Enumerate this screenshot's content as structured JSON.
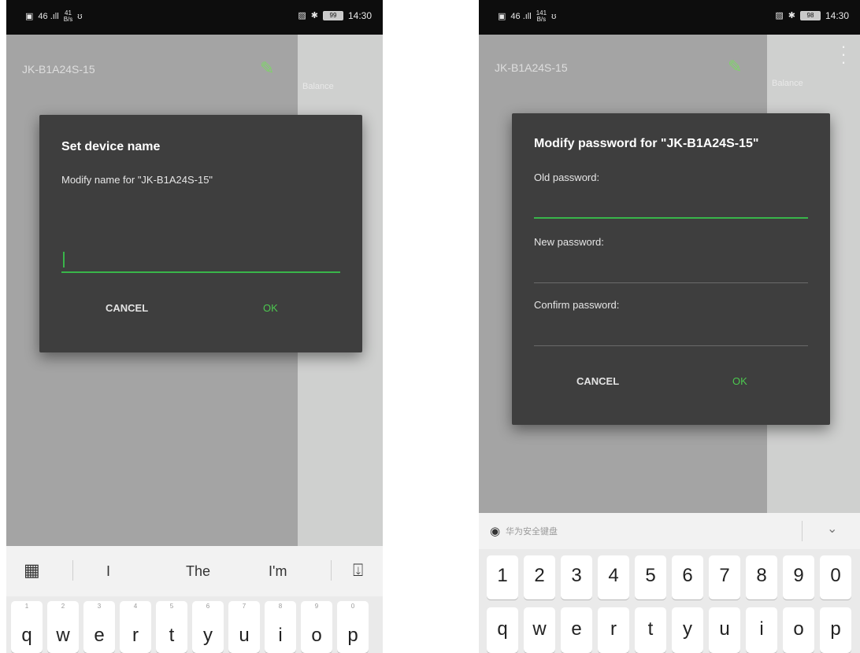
{
  "phone1": {
    "status": {
      "signal": "46 .ıll",
      "speed_top": "41",
      "speed_bottom": "B/s",
      "time": "14:30",
      "battery": "99"
    },
    "device_title": "JK-B1A24S-15",
    "balance_label": "Balance",
    "dialog": {
      "title": "Set device name",
      "message": "Modify name for \"JK-B1A24S-15\"",
      "cancel": "CANCEL",
      "ok": "OK"
    },
    "suggestions": [
      "I",
      "The",
      "I'm"
    ],
    "keys": [
      {
        "hint": "1",
        "ch": "q"
      },
      {
        "hint": "2",
        "ch": "w"
      },
      {
        "hint": "3",
        "ch": "e"
      },
      {
        "hint": "4",
        "ch": "r"
      },
      {
        "hint": "5",
        "ch": "t"
      },
      {
        "hint": "6",
        "ch": "y"
      },
      {
        "hint": "7",
        "ch": "u"
      },
      {
        "hint": "8",
        "ch": "i"
      },
      {
        "hint": "9",
        "ch": "o"
      },
      {
        "hint": "0",
        "ch": "p"
      }
    ]
  },
  "phone2": {
    "status": {
      "signal": "46 .ıll",
      "speed_top": "141",
      "speed_bottom": "B/s",
      "time": "14:30",
      "battery": "98"
    },
    "device_title": "JK-B1A24S-15",
    "balance_label": "Balance",
    "dialog": {
      "title": "Modify password for \"JK-B1A24S-15\"",
      "old_label": "Old password:",
      "new_label": "New password:",
      "confirm_label": "Confirm password:",
      "cancel": "CANCEL",
      "ok": "OK"
    },
    "keyboard_header": "华为安全键盘",
    "number_keys": [
      "1",
      "2",
      "3",
      "4",
      "5",
      "6",
      "7",
      "8",
      "9",
      "0"
    ],
    "letter_keys": [
      "q",
      "w",
      "e",
      "r",
      "t",
      "y",
      "u",
      "i",
      "o",
      "p"
    ]
  },
  "colors": {
    "accent": "#39b54a",
    "ok_text": "#4cc84f",
    "dialog_bg": "#3e3e3e",
    "overlay": "#a4a4a4"
  }
}
